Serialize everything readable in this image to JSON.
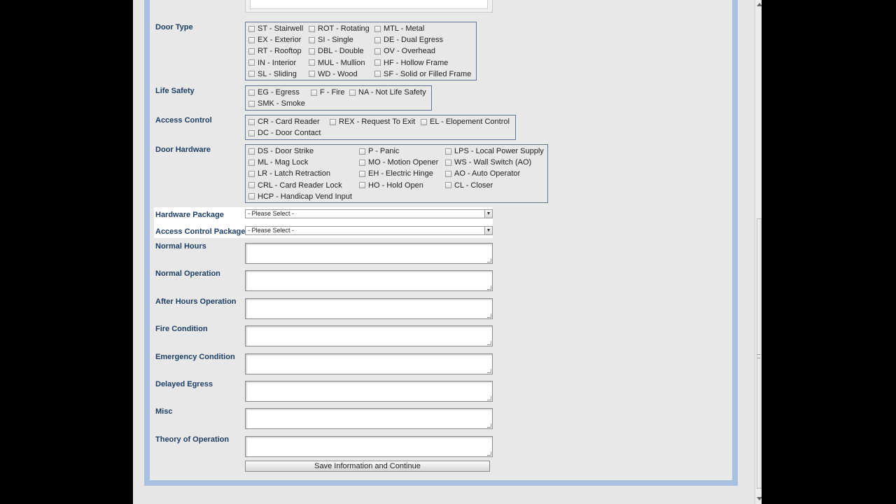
{
  "door_type": {
    "label": "Door Type",
    "options": [
      [
        "ST - Stairwell",
        "ROT - Rotating",
        "MTL - Metal"
      ],
      [
        "EX - Exterior",
        "SI - Single",
        "DE - Dual Egress"
      ],
      [
        "RT - Rooftop",
        "DBL - Double",
        "OV - Overhead"
      ],
      [
        "IN - Interior",
        "MUL - Mullion",
        "HF - Hollow Frame"
      ],
      [
        "SL - Sliding",
        "WD - Wood",
        "SF - Solid or Filled Frame"
      ]
    ]
  },
  "life_safety": {
    "label": "Life Safety",
    "options": [
      "EG - Egress",
      "F - Fire",
      "NA - Not Life Safety",
      "SMK - Smoke"
    ]
  },
  "access_control": {
    "label": "Access Control",
    "options": [
      "CR - Card Reader",
      "REX - Request To Exit",
      "EL - Elopement Control",
      "DC - Door Contact"
    ]
  },
  "door_hardware": {
    "label": "Door Hardware",
    "options": [
      [
        "DS - Door Strike",
        "P - Panic",
        "LPS - Local Power Supply"
      ],
      [
        "ML - Mag Lock",
        "MO - Motion Opener",
        "WS - Wall Switch (AO)"
      ],
      [
        "LR - Latch Retraction",
        "EH - Electric Hinge",
        "AO - Auto Operator"
      ],
      [
        "CRL - Card Reader Lock",
        "HO - Hold Open",
        "CL - Closer"
      ],
      [
        "HCP - Handicap Vend Input"
      ]
    ]
  },
  "hardware_package": {
    "label": "Hardware Package",
    "value": "- Please Select -"
  },
  "access_control_package": {
    "label": "Access Control Package",
    "value": "- Please Select -"
  },
  "text_fields": [
    "Normal Hours",
    "Normal Operation",
    "After Hours Operation",
    "Fire Condition",
    "Emergency Condition",
    "Delayed Egress",
    "Misc",
    "Theory of Operation"
  ],
  "save_button": "Save Information and Continue",
  "icons": {
    "dropdown": "chevron-down-icon",
    "resize": "resize-grip-icon"
  },
  "colors": {
    "label": "#1d3f66",
    "frame": "#a8c1e3",
    "background": "#e8e8e8"
  }
}
